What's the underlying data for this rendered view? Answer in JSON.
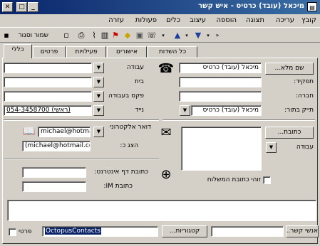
{
  "window": {
    "title": "מיכאל (עובד) כרטיס - איש קשר",
    "minimize_glyph": "_",
    "maximize_glyph": "□",
    "close_glyph": "✕"
  },
  "menubar": {
    "items": [
      "קובץ",
      "עריכה",
      "תצוגה",
      "הוספה",
      "עיצוב",
      "כלים",
      "פעולות",
      "עזרה"
    ]
  },
  "toolbar": {
    "save_close_label": "שמור וסגור"
  },
  "tabs": [
    "כללי",
    "פרטים",
    "פעילויות",
    "אישורים",
    "כל השדות"
  ],
  "phones": {
    "labels": [
      "עבודה",
      "בית",
      "פקס בעבודה",
      "נייד"
    ],
    "values": [
      "",
      "",
      "",
      "054-3458700 (ראשי)"
    ]
  },
  "name": {
    "full_name_button": "שם מלא...",
    "full_name_value": "מיכאל (עובד) כרטיס",
    "job_title_label": "תפקיד:",
    "company_label": "חברה:",
    "file_as_label": "תייק בתור:",
    "file_as_value": "מיכאל (עובד) כרטיס"
  },
  "email": {
    "label": "דואר אלקטרוני",
    "value": "michael@hotmail",
    "display_as_label": "הצג כ:",
    "display_as_value": "(michael@hotmail.com)"
  },
  "web": {
    "page_label": "כתובת דף אינטרנט:",
    "im_label": "כתובת IM:"
  },
  "address": {
    "button": "כתובת...",
    "type_label": "עבודה",
    "mailing_checkbox_label": "זוהי כתובת המשלוח"
  },
  "footer": {
    "contacts_button": "אנשי קשר...",
    "categories_button": "קטגוריות...",
    "categories_value": "OctopusContacts",
    "private_label": "פרטי"
  }
}
